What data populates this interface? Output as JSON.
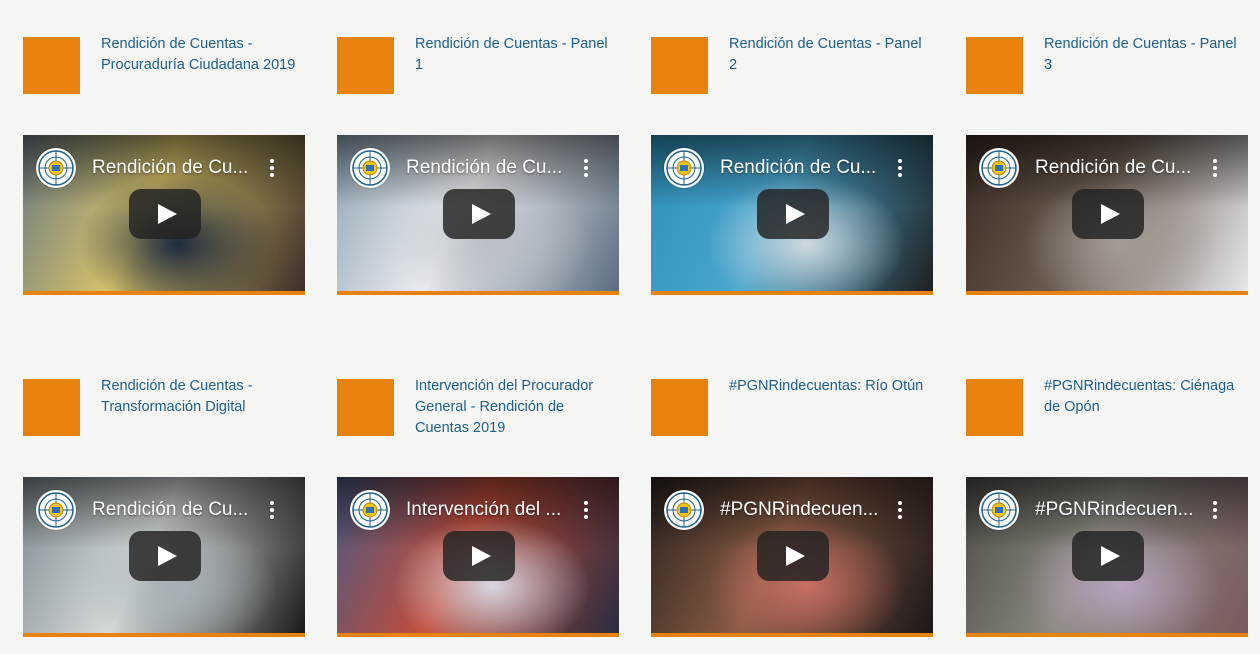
{
  "cards": [
    {
      "title": "Rendición de Cuentas - Procuraduría Ciudadana 2019",
      "video_title": "Rendición de Cu...",
      "colors": [
        "#6a7a80",
        "#d8c36a",
        "#3b2e2a",
        "#1d2a3e"
      ]
    },
    {
      "title": "Rendición de Cuentas - Panel 1",
      "video_title": "Rendición de Cu...",
      "colors": [
        "#8fa4b4",
        "#eceef0",
        "#5b6d7f",
        "#b9bfc5"
      ]
    },
    {
      "title": "Rendición de Cuentas - Panel 2",
      "video_title": "Rendición de Cu...",
      "colors": [
        "#2d8fb9",
        "#4aa7cf",
        "#202020",
        "#cfd9df"
      ]
    },
    {
      "title": "Rendición de Cuentas - Panel 3",
      "video_title": "Rendición de Cu...",
      "colors": [
        "#3a2a22",
        "#6a5b4f",
        "#e6e7ea",
        "#a39c96"
      ]
    },
    {
      "title": "Rendición de Cuentas - Transformación Digital",
      "video_title": "Rendición de Cu...",
      "colors": [
        "#7f8b90",
        "#d7dbdc",
        "#1a1a1a",
        "#a6b1b5"
      ]
    },
    {
      "title": "Intervención del Procurador General - Rendición de Cuentas 2019",
      "video_title": "Intervención del ...",
      "colors": [
        "#4b5a83",
        "#c44c3a",
        "#2a2d3f",
        "#d7d7e1"
      ]
    },
    {
      "title": "#PGNRindecuentas: Río Otún",
      "video_title": "#PGNRindecuen...",
      "colors": [
        "#2b241f",
        "#8b5c46",
        "#1b1818",
        "#c86e64"
      ]
    },
    {
      "title": "#PGNRindecuentas: Ciénaga de Opón",
      "video_title": "#PGNRindecuen...",
      "colors": [
        "#4d4b45",
        "#8c8a80",
        "#7a5a5e",
        "#b8a4c0"
      ]
    }
  ],
  "icons": {
    "avatar": "procuraduria-seal-icon",
    "menu": "more-vert-icon",
    "play": "play-icon"
  },
  "accent": "#e8820f",
  "link_color": "#1d5f8c"
}
